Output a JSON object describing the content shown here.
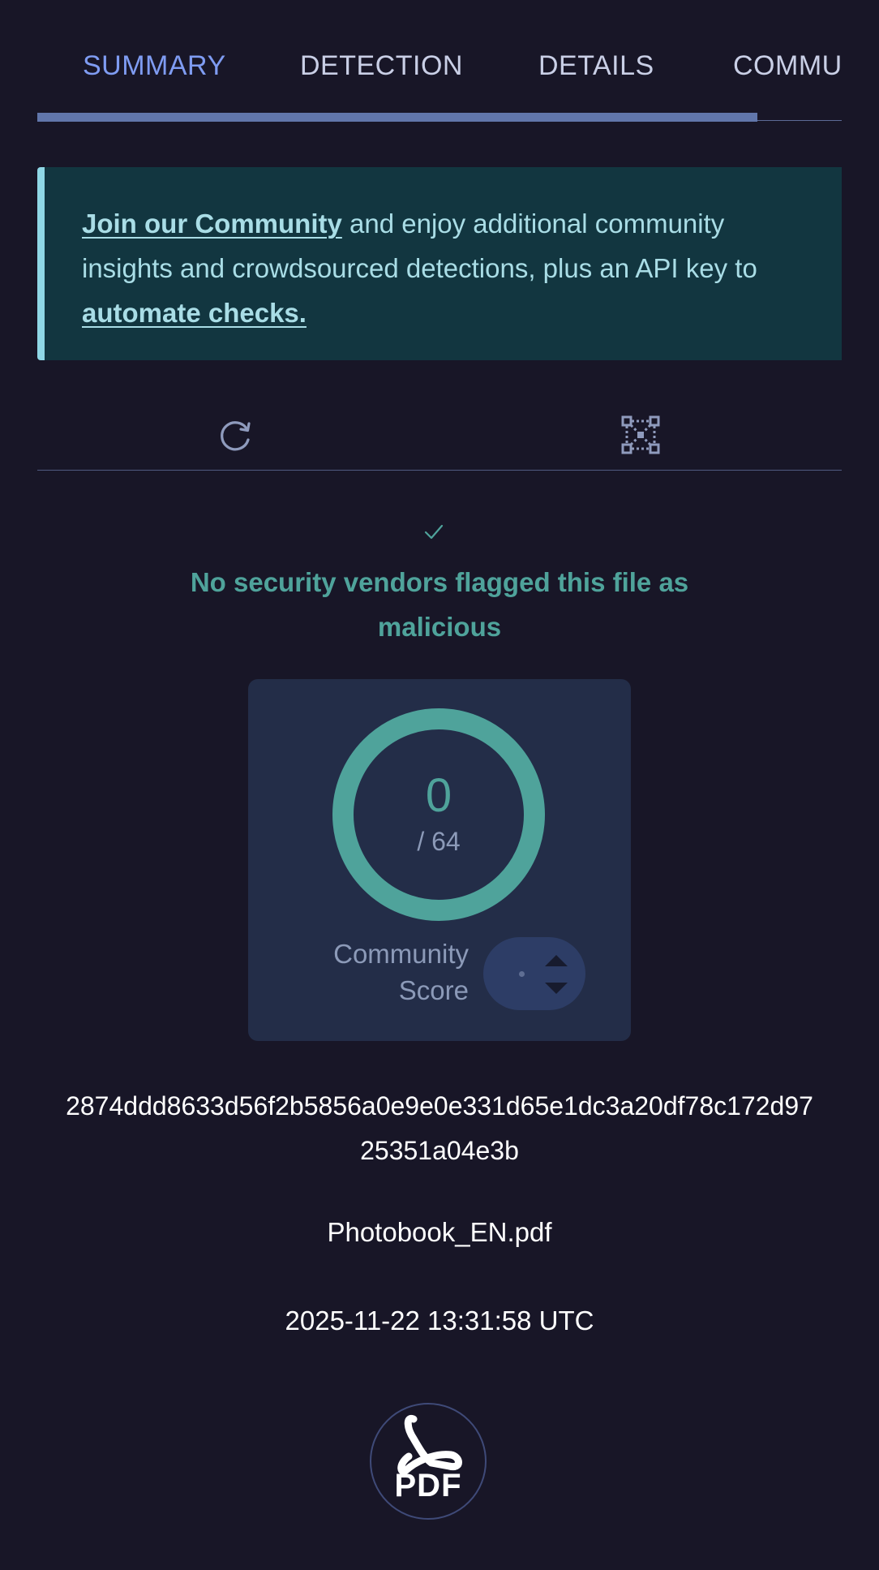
{
  "tabs": [
    {
      "label": "SUMMARY",
      "active": true
    },
    {
      "label": "DETECTION",
      "active": false
    },
    {
      "label": "DETAILS",
      "active": false
    },
    {
      "label": "COMMUNITY",
      "active": false
    }
  ],
  "banner": {
    "link_join": "Join our Community",
    "text_middle": " and enjoy additional community insights and crowdsourced detections, plus an API key to ",
    "link_automate": "automate checks."
  },
  "toolbar": {
    "reanalyze_icon": "refresh-icon",
    "graph_icon": "graph-overview-icon"
  },
  "verdict": {
    "icon": "check-icon",
    "text": "No security vendors flagged this file as malicious",
    "color": "#4fa39b"
  },
  "score": {
    "detections": "0",
    "total": "/ 64",
    "ring_color": "#4fa39b",
    "community_label": "Community Score"
  },
  "file": {
    "sha256": "2874ddd8633d56f2b5856a0e9e0e331d65e1dc3a20df78c172d9725351a04e3b",
    "name": "Photobook_EN.pdf",
    "scan_date": "2025-11-22 13:31:58 UTC",
    "type_label": "PDF",
    "type_icon": "pdf-file-icon"
  },
  "colors": {
    "background": "#181627",
    "accent": "#7f9cf2",
    "banner_bg": "#123640",
    "banner_text": "#a9dde6"
  }
}
